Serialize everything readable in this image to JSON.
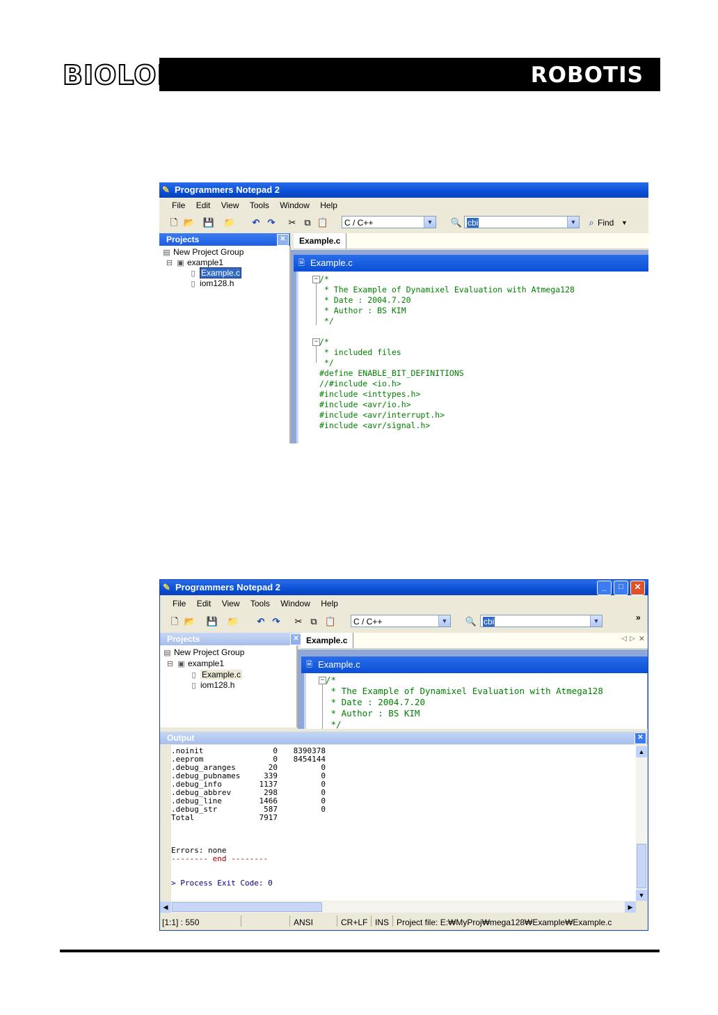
{
  "header": {
    "brand_left": "BIOLOID",
    "brand_right": "ROBOTIS"
  },
  "app": {
    "title": "Programmers Notepad 2"
  },
  "menu": [
    "File",
    "Edit",
    "View",
    "Tools",
    "Window",
    "Help"
  ],
  "toolbar": {
    "language": "C / C++",
    "search_text": "cbi",
    "find_label": "Find"
  },
  "projects_panel": {
    "title": "Projects",
    "items": [
      "New Project Group",
      "example1",
      "Example.c",
      "iom128.h"
    ]
  },
  "editor": {
    "tab_label": "Example.c",
    "doc_title": "Example.c",
    "code_lines": [
      "/*",
      " * The Example of Dynamixel Evaluation with Atmega128",
      " * Date : 2004.7.20",
      " * Author : BS KIM",
      " */",
      "",
      "/*",
      " * included files",
      " */",
      "#define ENABLE_BIT_DEFINITIONS",
      "//#include <io.h>",
      "#include <inttypes.h>",
      "#include <avr/io.h>",
      "#include <avr/interrupt.h>",
      "#include <avr/signal.h>"
    ]
  },
  "output_panel": {
    "title": "Output",
    "rows": [
      {
        "name": ".noinit",
        "size": "0",
        "addr": "8390378"
      },
      {
        "name": ".eeprom",
        "size": "0",
        "addr": "8454144"
      },
      {
        "name": ".debug_aranges",
        "size": "20",
        "addr": "0"
      },
      {
        "name": ".debug_pubnames",
        "size": "339",
        "addr": "0"
      },
      {
        "name": ".debug_info",
        "size": "1137",
        "addr": "0"
      },
      {
        "name": ".debug_abbrev",
        "size": "298",
        "addr": "0"
      },
      {
        "name": ".debug_line",
        "size": "1466",
        "addr": "0"
      },
      {
        "name": ".debug_str",
        "size": "587",
        "addr": "0"
      }
    ],
    "total_label": "Total",
    "total_value": "7917",
    "errors": "Errors: none",
    "end_line": "-------- end --------",
    "exit_line": "> Process Exit Code: 0"
  },
  "statusbar": {
    "position": "[1:1] : 550",
    "encoding": "ANSI",
    "line_ending": "CR+LF",
    "mode": "INS",
    "project_file": "Project file: E:₩MyProj₩mega128₩Example₩Example.c"
  },
  "colors": {
    "title_blue": "#0a4fd6",
    "code_green": "#008000",
    "end_red": "#a00000",
    "exit_blue": "#000080"
  }
}
